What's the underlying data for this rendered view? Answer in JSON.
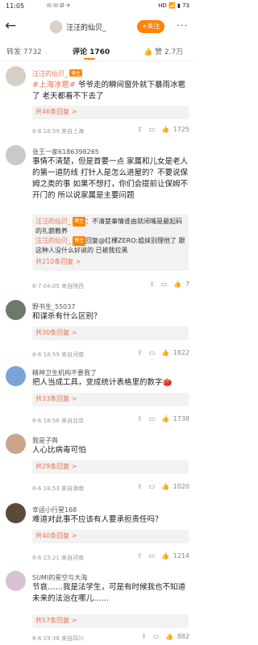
{
  "status": {
    "time": "11:05",
    "icons": "✉ ✉ Ø ✈",
    "right": "HD 📶 ▮ 73"
  },
  "header": {
    "back": "←",
    "title": "汪汪的仙贝_",
    "follow": "+关注",
    "more": "···"
  },
  "tabs": [
    {
      "label": "转发 7732"
    },
    {
      "label": "评论 1760"
    },
    {
      "label": "赞 2.7万"
    }
  ],
  "comments": [
    {
      "name": "汪汪的仙贝_",
      "badge": "博主",
      "tag": "#上海冰雹#",
      "text": " 爷爷走的瞬间窗外就下暴雨冰雹了 老天都看不下去了",
      "link": "共46条回复 >",
      "meta": "8-6 18:59 来自上海",
      "likes": "1725"
    },
    {
      "name": "张王一家6186398265",
      "text": "事情不清楚，但是首要一点 家属和儿女是老人的第一道防线 打针人是怎么进屋的？不要说保姆之类的事 如果不想打，你们会提前让保姆不开门的 所以说家属是主要问题",
      "replies": [
        {
          "name": "汪汪的仙贝_",
          "text": "：不清楚事情谁由就闭嘴是最起码的礼貌教养"
        },
        {
          "name": "汪汪的仙贝_",
          "text": "回复@红棵ZERO:姐妹别理他了 跟这种人没什么好说的 已被我拉黑"
        }
      ],
      "link": "共210条回复 >",
      "meta": "8-7 04:05 来自陕西",
      "likes": "7"
    },
    {
      "name": "野书生_55037",
      "text": "和谋杀有什么区别？",
      "link": "共30条回复 >",
      "meta": "8-6 18:59 来自河南",
      "likes": "1822"
    },
    {
      "name": "精神卫生机构不要我了",
      "text": "把人当成工具，变成统计表格里的数字🍅",
      "link": "共33条回复 >",
      "meta": "8-6 18:56 来自北京",
      "likes": "1738"
    },
    {
      "name": "我是子舆",
      "text": "人心比病毒可怕",
      "link": "共29条回复 >",
      "meta": "8-6 18:53 来自海南",
      "likes": "1020"
    },
    {
      "name": "幸运小行星168",
      "text": "难道对此事不应该有人要承担责任吗？",
      "link": "共40条回复 >",
      "meta": "8-6 15:21 来自河南",
      "likes": "1214"
    },
    {
      "name": "SUMI的星空与大海",
      "text": "节哀……我是法学生，可是有时候我也不知道未来的法治在哪儿……",
      "link": "共57条回复 >",
      "meta": "8-6 19:38 来自四川",
      "likes": "882"
    }
  ],
  "icons": {
    "share": "share-icon",
    "comment": "comment-icon",
    "like": "like-icon"
  },
  "colors": {
    "accent": "#ff8200",
    "link": "#eb7350"
  }
}
